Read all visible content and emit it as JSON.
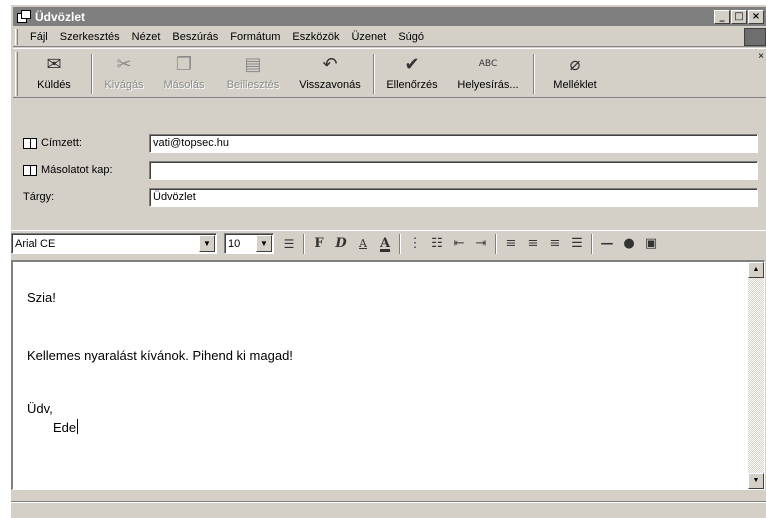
{
  "window": {
    "title": "Üdvözlet",
    "controls": {
      "minimize": "_",
      "maximize": "□",
      "close": "×"
    }
  },
  "menubar": {
    "items": [
      "Fájl",
      "Szerkesztés",
      "Nézet",
      "Beszúrás",
      "Formátum",
      "Eszközök",
      "Üzenet",
      "Súgó"
    ]
  },
  "toolbar": {
    "send": "Küldés",
    "cut": "Kivágás",
    "copy": "Másolás",
    "paste": "Beillesztés",
    "undo": "Visszavonás",
    "check": "Ellenőrzés",
    "spelling": "Helyesírás...",
    "attach": "Melléklet",
    "close_glyph": "×",
    "spelling_icon_text": "ABC"
  },
  "header": {
    "to_label": "Címzett:",
    "to_value": "vati@topsec.hu",
    "cc_label": "Másolatot kap:",
    "cc_value": "",
    "subject_label": "Tárgy:",
    "subject_value": "Üdvözlet"
  },
  "format": {
    "font": "Arial CE",
    "size": "10",
    "bold": "F",
    "italic": "D",
    "underline_a": "A",
    "color_a": "A"
  },
  "body": {
    "line1": "Szia!",
    "line2": "Kellemes nyaralást kívánok. Pihend ki magad!",
    "line3": "Üdv,",
    "line4": "Ede"
  },
  "colors": {
    "chrome": "#d4d0c8",
    "titlebar_inactive": "#7f7f7f"
  }
}
